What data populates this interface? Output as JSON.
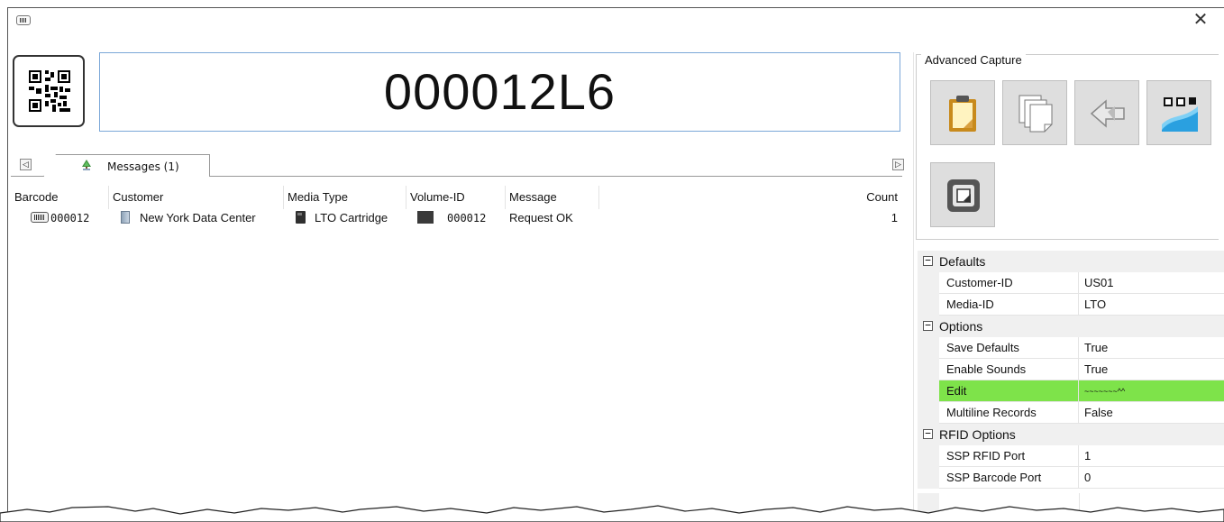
{
  "window": {
    "icon": "barcode-icon",
    "close_label": "✕"
  },
  "barcode": {
    "scan_button_icon": "qr-code-icon",
    "value": "000012L6"
  },
  "tabs": {
    "scroll_left": "◁",
    "scroll_right": "▷",
    "items": [
      {
        "label": "Messages (1)",
        "icon": "tree-icon",
        "active": true
      }
    ]
  },
  "grid": {
    "columns": [
      "Barcode",
      "Customer",
      "Media Type",
      "Volume-ID",
      "Message",
      "Count"
    ],
    "rows": [
      {
        "barcode": "000012",
        "customer": "New York Data Center",
        "media_type": "LTO Cartridge",
        "volume_id": "000012",
        "message": "Request OK",
        "count": "1"
      }
    ]
  },
  "advanced_capture": {
    "title": "Advanced Capture",
    "buttons": [
      {
        "name": "clipboard-capture-button",
        "icon": "clipboard-icon"
      },
      {
        "name": "copy-capture-button",
        "icon": "documents-icon"
      },
      {
        "name": "transfer-capture-button",
        "icon": "arrow-exchange-icon"
      },
      {
        "name": "qr-capture-button",
        "icon": "qr-wave-icon"
      },
      {
        "name": "rfid-capture-button",
        "icon": "rfid-chip-icon"
      }
    ]
  },
  "properties": {
    "categories": [
      {
        "label": "Defaults",
        "toggle": "⊟",
        "items": [
          {
            "name": "Customer-ID",
            "value": "US01"
          },
          {
            "name": "Media-ID",
            "value": "LTO"
          }
        ]
      },
      {
        "label": "Options",
        "toggle": "⊟",
        "items": [
          {
            "name": "Save Defaults",
            "value": "True"
          },
          {
            "name": "Enable Sounds",
            "value": "True"
          },
          {
            "name": "Edit",
            "value": "~~~~~~~^^",
            "selected": true
          },
          {
            "name": "Multiline Records",
            "value": "False"
          }
        ]
      },
      {
        "label": "RFID Options",
        "toggle": "⊟",
        "items": [
          {
            "name": "SSP RFID Port",
            "value": "1"
          },
          {
            "name": "SSP Barcode Port",
            "value": "0"
          }
        ]
      }
    ],
    "selected_color": "#7ee34a"
  }
}
